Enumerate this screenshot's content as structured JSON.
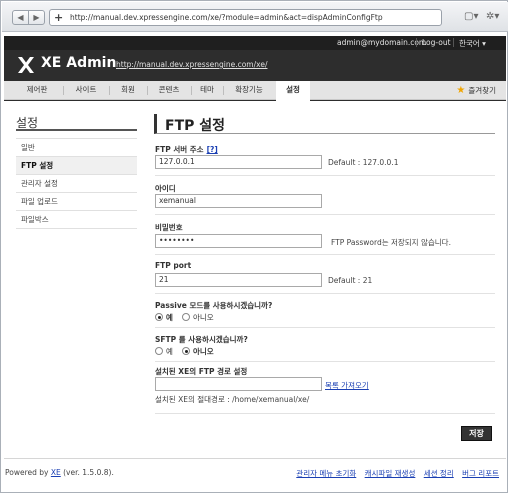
{
  "browser": {
    "back_icon": "◀",
    "forward_icon": "▶",
    "plus_icon": "+",
    "url": "http://manual.dev.xpressengine.com/xe/?module=admin&act=dispAdminConfigFtp",
    "page_icon": "▢▾",
    "gear_icon": "✲▾"
  },
  "topbar": {
    "email": "admin@mydomain.com",
    "logout": "Log-out",
    "language": "한국어 ▾"
  },
  "brand": {
    "title": "XE Admin",
    "site_url": "http://manual.dev.xpressengine.com/xe/"
  },
  "menu": {
    "items": [
      "제어판",
      "사이트",
      "회원",
      "콘텐츠",
      "테마",
      "확장기능",
      "설정"
    ],
    "active_index": 6,
    "favorites": "즐겨찾기"
  },
  "sidebar": {
    "title": "설정",
    "items": [
      "일반",
      "FTP 설정",
      "관리자 설정",
      "파일 업로드",
      "파일박스"
    ],
    "active_index": 1
  },
  "main": {
    "title": "FTP 설정",
    "server_label": "FTP 서버 주소",
    "server_help": "[?]",
    "server_value": "127.0.0.1",
    "server_default": "Default : 127.0.0.1",
    "id_label": "아이디",
    "id_value": "xemanual",
    "pw_label": "비밀번호",
    "pw_value": "••••••••",
    "pw_note": "FTP Password는 저장되지 않습니다.",
    "port_label": "FTP port",
    "port_value": "21",
    "port_default": "Default : 21",
    "passive_label": "Passive 모드를 사용하시겠습니까?",
    "passive_yes": "예",
    "passive_no": "아니오",
    "sftp_label": "SFTP 를 사용하시겠습니까?",
    "sftp_yes": "예",
    "sftp_no": "아니오",
    "path_label": "설치된 XE의 FTP 경로 설정",
    "path_value": "",
    "path_link": "목록 가져오기",
    "abs_path": "설치된 XE의 절대경로 : /home/xemanual/xe/",
    "save": "저장"
  },
  "footer": {
    "powered_prefix": "Powered by ",
    "powered_link": "XE",
    "powered_suffix": " (ver. 1.5.0.8).",
    "links": [
      "관리자 메뉴 초기화",
      "캐시파일 재생성",
      "세션 정리",
      "버그 리포트"
    ]
  }
}
